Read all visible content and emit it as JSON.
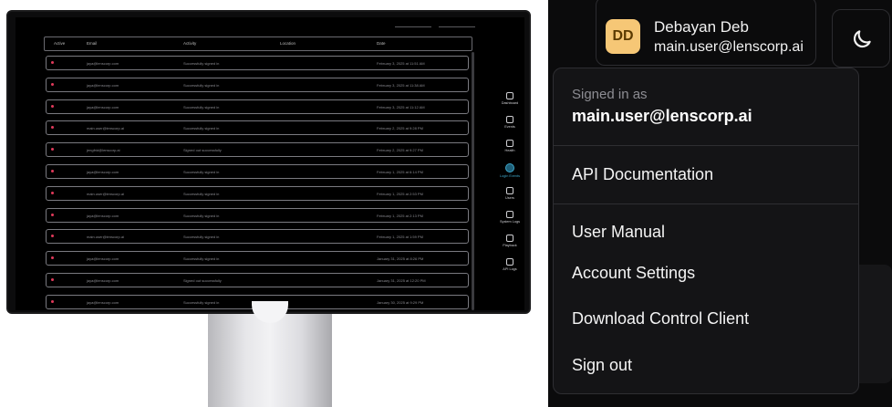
{
  "monitor": {
    "table": {
      "columns": [
        "Active",
        "Email",
        "Activity",
        "Location",
        "Date"
      ],
      "rows": [
        {
          "email": "jaya@lenscorp.com",
          "activity": "Successfully signed in",
          "date": "February 3, 2025 at 11:51 AM"
        },
        {
          "email": "jaya@lenscorp.com",
          "activity": "Successfully signed in",
          "date": "February 3, 2025 at 11:38 AM"
        },
        {
          "email": "jaya@lenscorp.com",
          "activity": "Successfully signed in",
          "date": "February 3, 2025 at 11:12 AM"
        },
        {
          "email": "main.user@lenscorp.ai",
          "activity": "Successfully signed in",
          "date": "February 2, 2025 at 9:28 PM"
        },
        {
          "email": "jengfrid@lenscorp.ai",
          "activity": "Signed out successfully",
          "date": "February 2, 2025 at 9:27 PM"
        },
        {
          "email": "jaya@lenscorp.com",
          "activity": "Successfully signed in",
          "date": "February 1, 2025 at 6:14 PM"
        },
        {
          "email": "main.user@lenscorp.ai",
          "activity": "Successfully signed in",
          "date": "February 1, 2025 at 2:53 PM"
        },
        {
          "email": "jaya@lenscorp.com",
          "activity": "Successfully signed in",
          "date": "February 1, 2025 at 2:13 PM"
        },
        {
          "email": "main.user@lenscorp.ai",
          "activity": "Successfully signed in",
          "date": "February 1, 2025 at 1:59 PM"
        },
        {
          "email": "jaya@lenscorp.com",
          "activity": "Successfully signed in",
          "date": "January 31, 2025 at 8:26 PM"
        },
        {
          "email": "jaya@lenscorp.com",
          "activity": "Signed out successfully",
          "date": "January 31, 2025 at 12:20 PM"
        },
        {
          "email": "jaya@lenscorp.com",
          "activity": "Successfully signed in",
          "date": "January 30, 2025 at 9:29 PM"
        }
      ]
    },
    "sidebar": [
      {
        "label": "Dashboard",
        "icon": "dashboard-icon"
      },
      {
        "label": "Events",
        "icon": "events-icon"
      },
      {
        "label": "Health",
        "icon": "health-icon"
      },
      {
        "label": "Login Events",
        "icon": "login-events-icon",
        "active": true
      },
      {
        "label": "Users",
        "icon": "users-icon"
      },
      {
        "label": "System Logs",
        "icon": "system-logs-icon"
      },
      {
        "label": "Playback",
        "icon": "playback-icon"
      },
      {
        "label": "API Logs",
        "icon": "api-logs-icon"
      }
    ],
    "accent_color": "#3ea6c9",
    "status_dot_color": "#e03a5a"
  },
  "user": {
    "initials": "DD",
    "name": "Debayan Deb",
    "email": "main.user@lenscorp.ai",
    "avatar_color": "#f6c776"
  },
  "theme_toggle": {
    "icon": "moon-icon"
  },
  "menu": {
    "signed_in_label": "Signed in as",
    "signed_in_email": "main.user@lenscorp.ai",
    "items": [
      "API Documentation",
      "User Manual",
      "Account Settings",
      "Download Control Client",
      "Sign out"
    ]
  }
}
